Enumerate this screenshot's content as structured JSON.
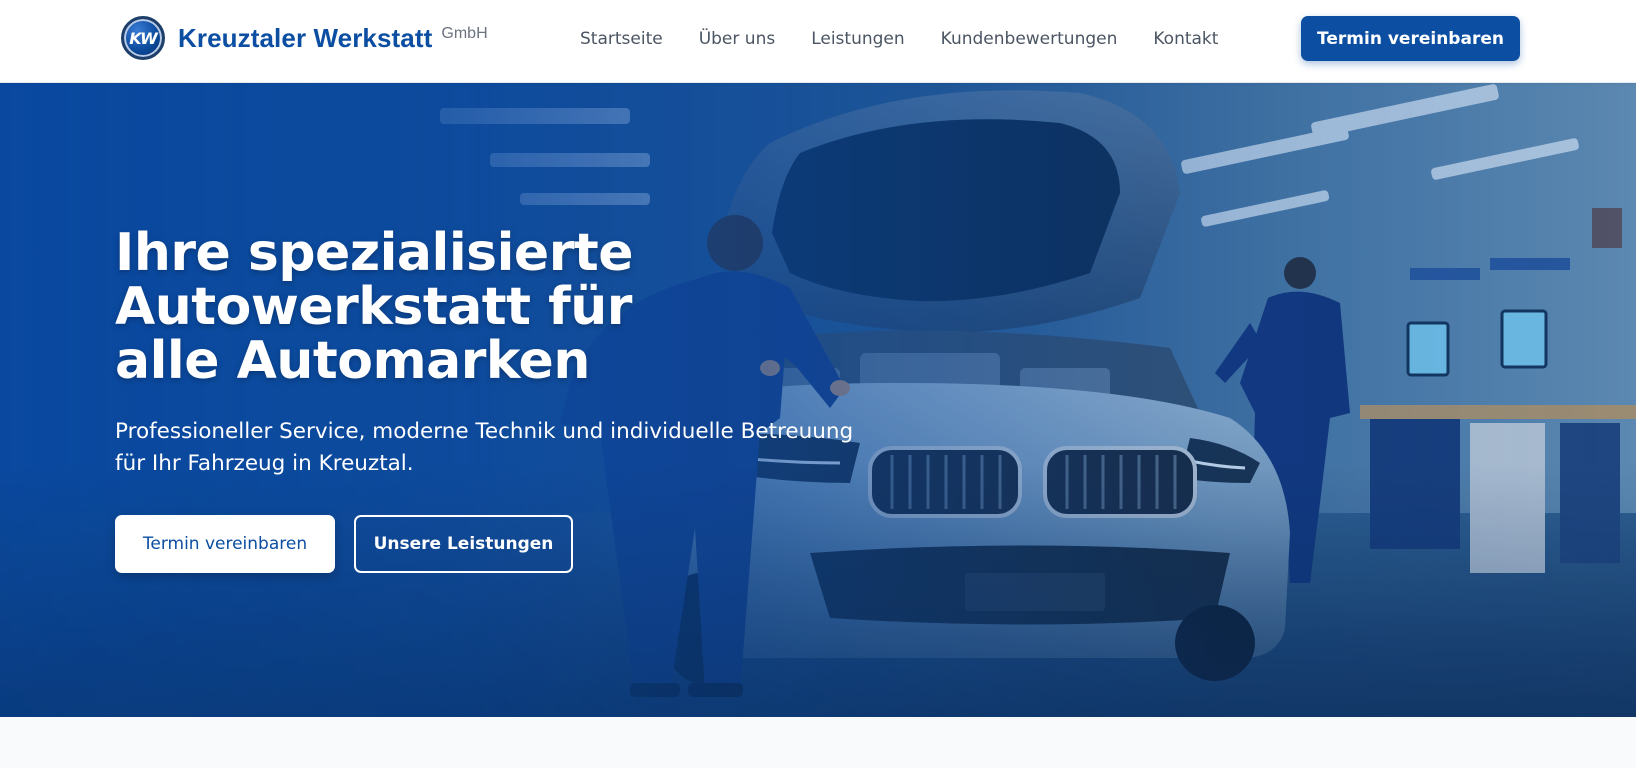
{
  "header": {
    "logo_initials": "KW",
    "brand_name": "Kreuztaler Werkstatt",
    "brand_suffix": "GmbH",
    "nav": [
      {
        "label": "Startseite"
      },
      {
        "label": "Über uns"
      },
      {
        "label": "Leistungen"
      },
      {
        "label": "Kundenbewertungen"
      },
      {
        "label": "Kontakt"
      }
    ],
    "cta_label": "Termin vereinbaren"
  },
  "hero": {
    "title": "Ihre spezialisierte Autowerkstatt für alle Automarken",
    "subtitle": "Professioneller Service, moderne Technik und individuelle Betreuung für Ihr Fahrzeug in Kreuztal.",
    "primary_button": "Termin vereinbaren",
    "secondary_button": "Unsere Leistungen",
    "background_image": "mechanic-working-on-car-in-workshop"
  },
  "colors": {
    "brand_blue": "#0b4ea2",
    "nav_text": "#4b5563",
    "page_background": "#f8fafc",
    "hero_overlay": "#0a4aa3"
  }
}
